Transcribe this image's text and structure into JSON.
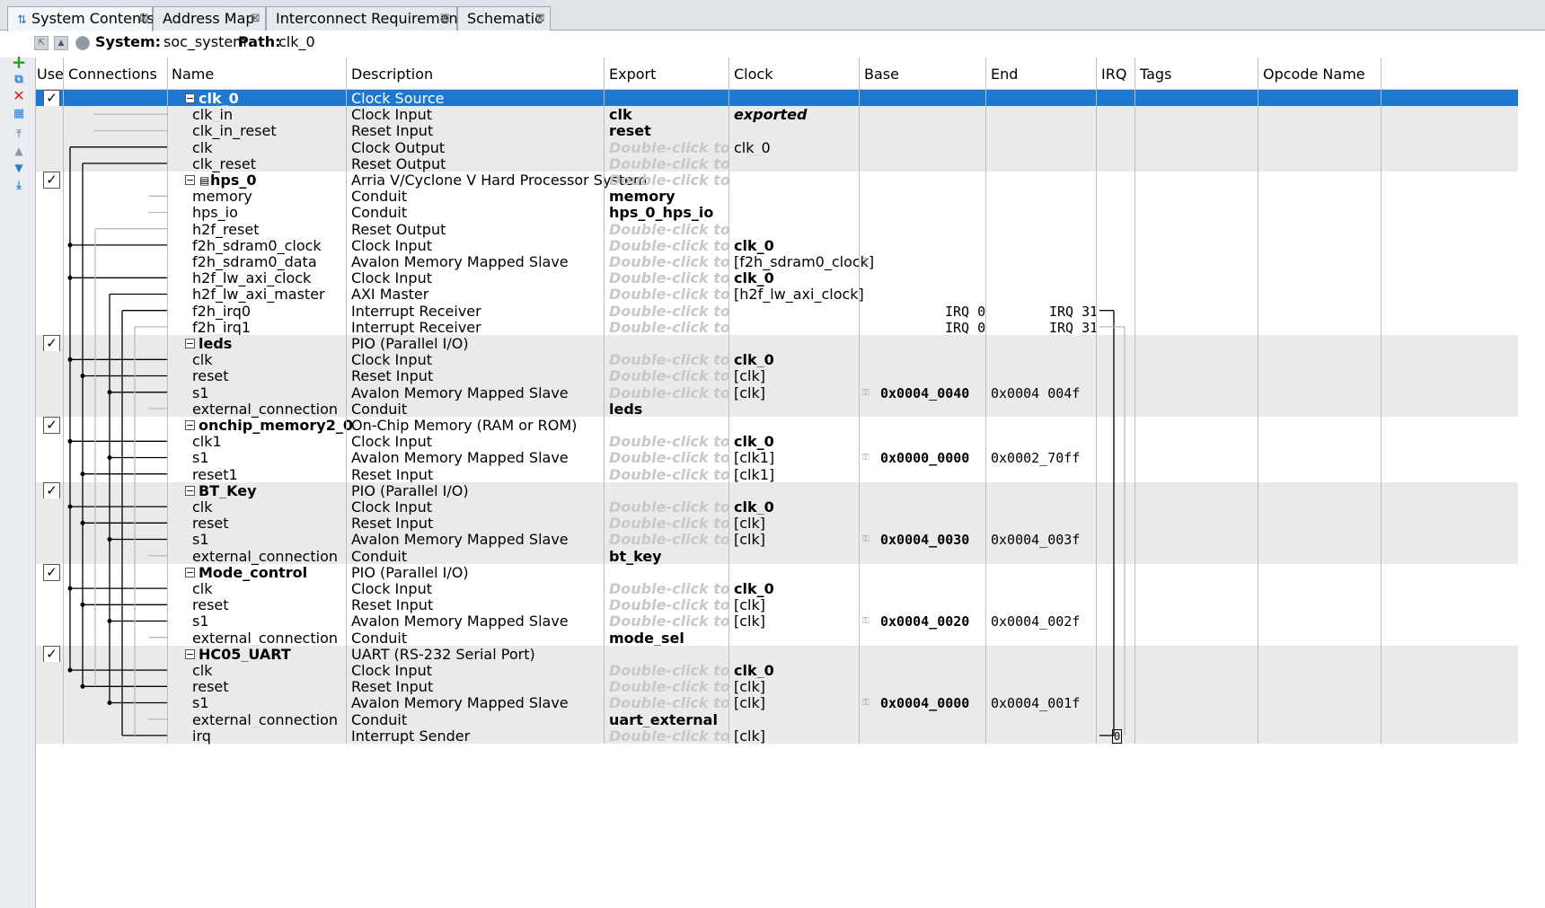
{
  "tabs": [
    {
      "label": "System Contents",
      "active": true
    },
    {
      "label": "Address Map",
      "active": false
    },
    {
      "label": "Interconnect Requirements",
      "active": false
    },
    {
      "label": "Schematic",
      "active": false
    }
  ],
  "system_bar": {
    "system_label": "System:",
    "system_value": "soc_system",
    "path_label": "Path:",
    "path_value": "clk_0"
  },
  "columns": {
    "use": "Use",
    "connections": "Connections",
    "name": "Name",
    "description": "Description",
    "export": "Export",
    "clock": "Clock",
    "base": "Base",
    "end": "End",
    "irq": "IRQ",
    "tags": "Tags",
    "opcode": "Opcode Name"
  },
  "double_click_text": "Double-click to",
  "rows": [
    {
      "kind": "module",
      "name": "clk_0",
      "desc": "Clock Source",
      "export": "",
      "clock": "",
      "base": "",
      "end": "",
      "checked": true,
      "selected": true
    },
    {
      "kind": "port",
      "name": "clk_in",
      "desc": "Clock Input",
      "export": "clk",
      "export_bold": true,
      "clock": "exported",
      "clock_style": "bolditalic"
    },
    {
      "kind": "port",
      "name": "clk_in_reset",
      "desc": "Reset Input",
      "export": "reset",
      "export_bold": true,
      "clock": ""
    },
    {
      "kind": "port",
      "name": "clk",
      "desc": "Clock Output",
      "export": "@dbl",
      "clock": "clk_0"
    },
    {
      "kind": "port",
      "name": "clk_reset",
      "desc": "Reset Output",
      "export": "@dbl",
      "clock": ""
    },
    {
      "kind": "module",
      "name": "hps_0",
      "desc": "Arria V/Cyclone V Hard Processor System",
      "export": "@dbl",
      "checked": true,
      "hps": true
    },
    {
      "kind": "port",
      "name": "memory",
      "desc": "Conduit",
      "export": "memory",
      "export_bold": true,
      "clock": ""
    },
    {
      "kind": "port",
      "name": "hps_io",
      "desc": "Conduit",
      "export": "hps_0_hps_io",
      "export_bold": true,
      "clock": ""
    },
    {
      "kind": "port",
      "name": "h2f_reset",
      "desc": "Reset Output",
      "export": "@dbl",
      "clock": ""
    },
    {
      "kind": "port",
      "name": "f2h_sdram0_clock",
      "desc": "Clock Input",
      "export": "@dbl",
      "clock": "clk_0",
      "clock_style": "bold"
    },
    {
      "kind": "port",
      "name": "f2h_sdram0_data",
      "desc": "Avalon Memory Mapped Slave",
      "export": "@dbl",
      "clock": "[f2h_sdram0_clock]",
      "pin": true
    },
    {
      "kind": "port",
      "name": "h2f_lw_axi_clock",
      "desc": "Clock Input",
      "export": "@dbl",
      "clock": "clk_0",
      "clock_style": "bold"
    },
    {
      "kind": "port",
      "name": "h2f_lw_axi_master",
      "desc": "AXI Master",
      "export": "@dbl",
      "clock": "[h2f_lw_axi_clock]"
    },
    {
      "kind": "port",
      "name": "f2h_irq0",
      "desc": "Interrupt Receiver",
      "export": "@dbl",
      "clock": "",
      "irq_lo": "IRQ 0",
      "irq_hi": "IRQ 31"
    },
    {
      "kind": "port",
      "name": "f2h_irq1",
      "desc": "Interrupt Receiver",
      "export": "@dbl",
      "clock": "",
      "irq_lo": "IRQ 0",
      "irq_hi": "IRQ 31"
    },
    {
      "kind": "module",
      "name": "leds",
      "desc": "PIO (Parallel I/O)",
      "checked": true
    },
    {
      "kind": "port",
      "name": "clk",
      "desc": "Clock Input",
      "export": "@dbl",
      "clock": "clk_0",
      "clock_style": "bold"
    },
    {
      "kind": "port",
      "name": "reset",
      "desc": "Reset Input",
      "export": "@dbl",
      "clock": "[clk]"
    },
    {
      "kind": "port",
      "name": "s1",
      "desc": "Avalon Memory Mapped Slave",
      "export": "@dbl",
      "clock": "[clk]",
      "base": "0x0004_0040",
      "end": "0x0004_004f",
      "pin": true
    },
    {
      "kind": "port",
      "name": "external_connection",
      "desc": "Conduit",
      "export": "leds",
      "export_bold": true,
      "clock": ""
    },
    {
      "kind": "module",
      "name": "onchip_memory2_0",
      "desc": "On-Chip Memory (RAM or ROM)",
      "checked": true
    },
    {
      "kind": "port",
      "name": "clk1",
      "desc": "Clock Input",
      "export": "@dbl",
      "clock": "clk_0",
      "clock_style": "bold"
    },
    {
      "kind": "port",
      "name": "s1",
      "desc": "Avalon Memory Mapped Slave",
      "export": "@dbl",
      "clock": "[clk1]",
      "base": "0x0000_0000",
      "end": "0x0002_70ff",
      "pin": true
    },
    {
      "kind": "port",
      "name": "reset1",
      "desc": "Reset Input",
      "export": "@dbl",
      "clock": "[clk1]"
    },
    {
      "kind": "module",
      "name": "BT_Key",
      "desc": "PIO (Parallel I/O)",
      "checked": true
    },
    {
      "kind": "port",
      "name": "clk",
      "desc": "Clock Input",
      "export": "@dbl",
      "clock": "clk_0",
      "clock_style": "bold"
    },
    {
      "kind": "port",
      "name": "reset",
      "desc": "Reset Input",
      "export": "@dbl",
      "clock": "[clk]"
    },
    {
      "kind": "port",
      "name": "s1",
      "desc": "Avalon Memory Mapped Slave",
      "export": "@dbl",
      "clock": "[clk]",
      "base": "0x0004_0030",
      "end": "0x0004_003f",
      "pin": true
    },
    {
      "kind": "port",
      "name": "external_connection",
      "desc": "Conduit",
      "export": "bt_key",
      "export_bold": true,
      "clock": ""
    },
    {
      "kind": "module",
      "name": "Mode_control",
      "desc": "PIO (Parallel I/O)",
      "checked": true
    },
    {
      "kind": "port",
      "name": "clk",
      "desc": "Clock Input",
      "export": "@dbl",
      "clock": "clk_0",
      "clock_style": "bold"
    },
    {
      "kind": "port",
      "name": "reset",
      "desc": "Reset Input",
      "export": "@dbl",
      "clock": "[clk]"
    },
    {
      "kind": "port",
      "name": "s1",
      "desc": "Avalon Memory Mapped Slave",
      "export": "@dbl",
      "clock": "[clk]",
      "base": "0x0004_0020",
      "end": "0x0004_002f",
      "pin": true
    },
    {
      "kind": "port",
      "name": "external_connection",
      "desc": "Conduit",
      "export": "mode_sel",
      "export_bold": true,
      "clock": ""
    },
    {
      "kind": "module",
      "name": "HC05_UART",
      "desc": "UART (RS-232 Serial Port)",
      "checked": true
    },
    {
      "kind": "port",
      "name": "clk",
      "desc": "Clock Input",
      "export": "@dbl",
      "clock": "clk_0",
      "clock_style": "bold"
    },
    {
      "kind": "port",
      "name": "reset",
      "desc": "Reset Input",
      "export": "@dbl",
      "clock": "[clk]"
    },
    {
      "kind": "port",
      "name": "s1",
      "desc": "Avalon Memory Mapped Slave",
      "export": "@dbl",
      "clock": "[clk]",
      "base": "0x0004_0000",
      "end": "0x0004_001f",
      "pin": true
    },
    {
      "kind": "port",
      "name": "external_connection",
      "desc": "Conduit",
      "export": "uart_external",
      "export_bold": true,
      "clock": ""
    },
    {
      "kind": "port",
      "name": "irq",
      "desc": "Interrupt Sender",
      "export": "@dbl",
      "clock": "[clk]",
      "irq_val": "0"
    }
  ],
  "colors": {
    "selection": "#1e78d2",
    "alt_row": "#eaeaea",
    "tool_green": "#2a9d2a",
    "tool_red": "#d42020",
    "tool_blue": "#2a7fd4"
  }
}
